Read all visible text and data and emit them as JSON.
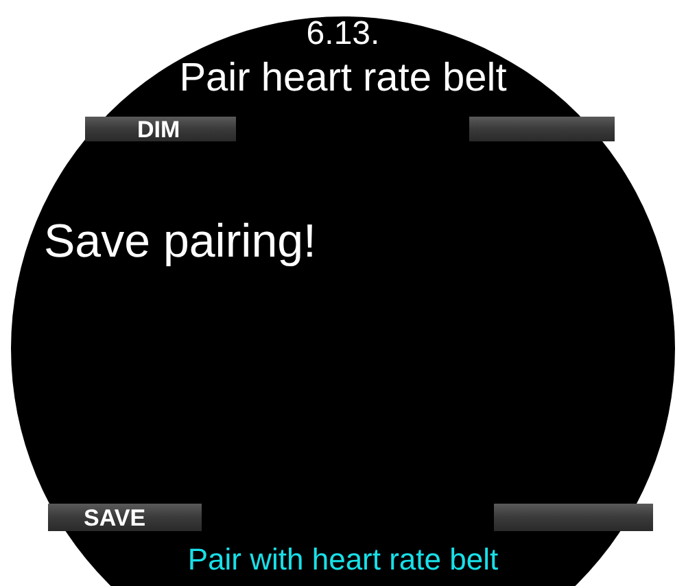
{
  "screen": {
    "section_number": "6.13.",
    "title": "Pair heart rate belt"
  },
  "top_keys": {
    "left": "DIM"
  },
  "message": "Save pairing!",
  "bottom_keys": {
    "left": "SAVE"
  },
  "footer": "Pair with heart rate belt"
}
